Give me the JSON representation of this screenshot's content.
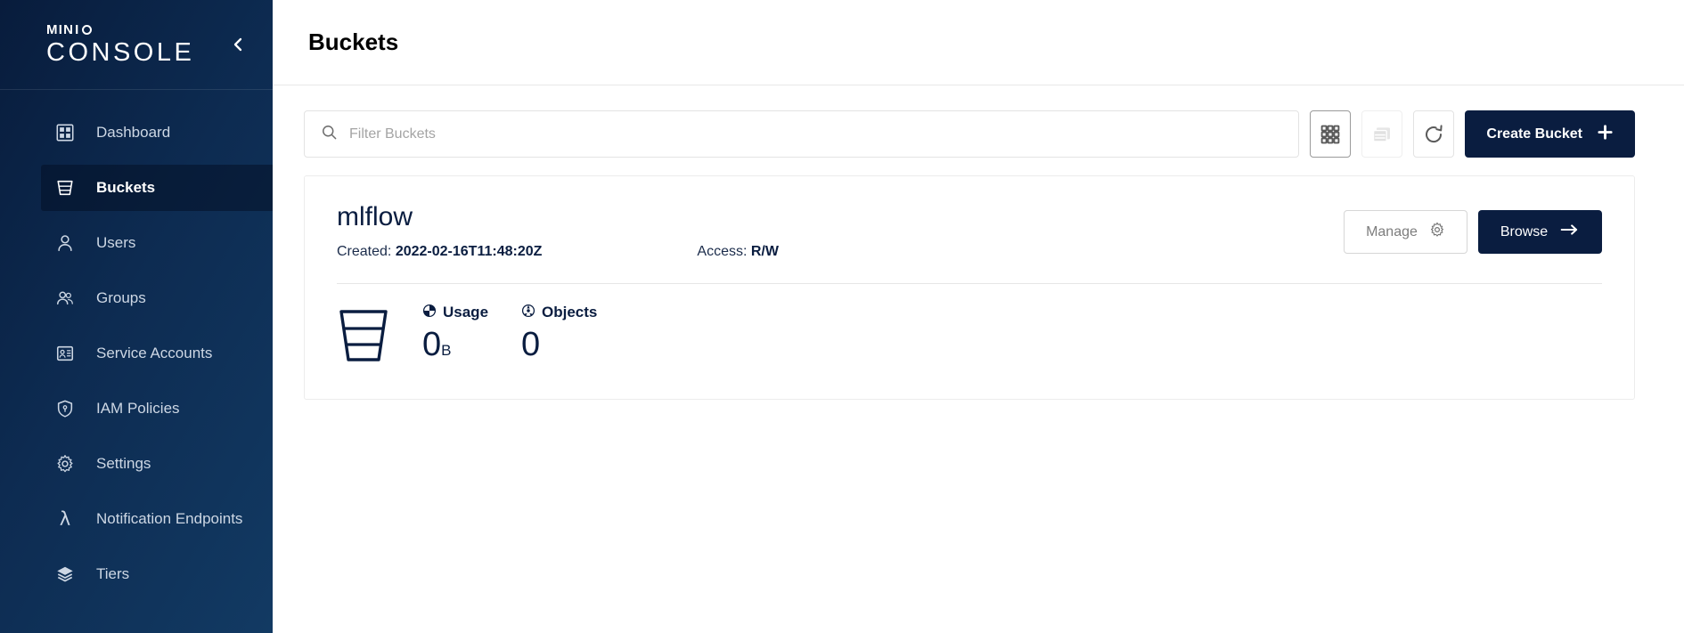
{
  "sidebar": {
    "logo_top": "MIN",
    "logo_top_suffix": "I",
    "logo_bottom": "CONSOLE",
    "collapse_icon": "chevron-left-icon",
    "items": [
      {
        "label": "Dashboard",
        "icon": "dashboard-icon",
        "active": false
      },
      {
        "label": "Buckets",
        "icon": "bucket-icon",
        "active": true
      },
      {
        "label": "Users",
        "icon": "user-icon",
        "active": false
      },
      {
        "label": "Groups",
        "icon": "groups-icon",
        "active": false
      },
      {
        "label": "Service Accounts",
        "icon": "id-card-icon",
        "active": false
      },
      {
        "label": "IAM Policies",
        "icon": "shield-icon",
        "active": false
      },
      {
        "label": "Settings",
        "icon": "gear-icon",
        "active": false
      },
      {
        "label": "Notification Endpoints",
        "icon": "lambda-icon",
        "active": false
      },
      {
        "label": "Tiers",
        "icon": "layers-icon",
        "active": false
      }
    ]
  },
  "header": {
    "title": "Buckets"
  },
  "toolbar": {
    "search_placeholder": "Filter Buckets",
    "search_value": "",
    "search_icon": "search-icon",
    "grid_view_icon": "grid-view-icon",
    "list_view_icon": "list-view-icon",
    "refresh_icon": "refresh-icon",
    "create_label": "Create Bucket",
    "create_icon": "plus-icon"
  },
  "buckets": [
    {
      "name": "mlflow",
      "created_label": "Created:",
      "created_value": "2022-02-16T11:48:20Z",
      "access_label": "Access:",
      "access_value": "R/W",
      "manage_label": "Manage",
      "manage_icon": "gear-icon",
      "browse_label": "Browse",
      "browse_icon": "arrow-right-icon",
      "bucket_glyph_icon": "bucket-icon",
      "usage_label": "Usage",
      "usage_icon": "pie-chart-icon",
      "usage_value": "0",
      "usage_unit": "B",
      "objects_label": "Objects",
      "objects_icon": "report-icon",
      "objects_value": "0"
    }
  ],
  "colors": {
    "sidebar_dark": "#081c3c",
    "sidebar_light": "#123a63",
    "accent_navy": "#0a1d40",
    "active_item_bg": "#031026",
    "border_grey": "#e3e3e3",
    "placeholder_grey": "#a4a4a4"
  }
}
